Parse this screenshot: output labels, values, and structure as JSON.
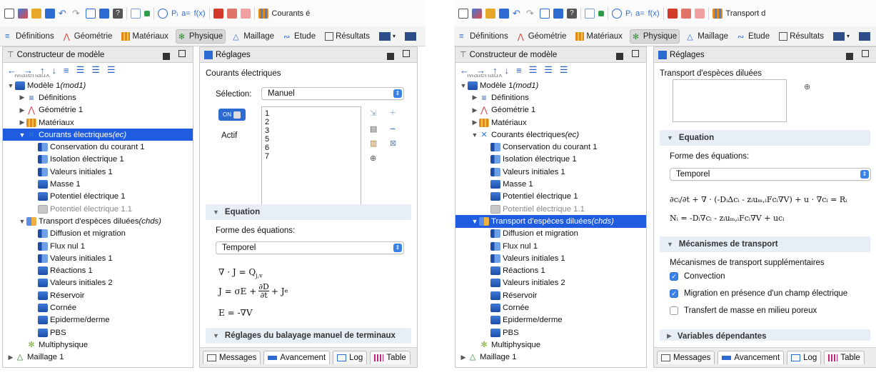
{
  "quick_access_left": {
    "truncated_title": "Courants é"
  },
  "quick_access_right": {
    "truncated_title": "Transport d"
  },
  "ribbon": {
    "tabs": [
      "Définitions",
      "Géométrie",
      "Matériaux",
      "Physique",
      "Maillage",
      "Etude",
      "Résultats"
    ],
    "active_tab": "Physique"
  },
  "builder": {
    "title": "Constructeur de modèle"
  },
  "left": {
    "tree": [
      {
        "indent": 0,
        "twisty": "",
        "icon": "none",
        "label": "Matériaux",
        "dim": true,
        "partial": true
      },
      {
        "indent": 0,
        "twisty": "▼",
        "icon": "blue",
        "label": "Modèle 1 ",
        "italic": "(mod1)"
      },
      {
        "indent": 1,
        "twisty": "▶",
        "icon": "def",
        "label": "Définitions"
      },
      {
        "indent": 1,
        "twisty": "▶",
        "icon": "geo",
        "label": "Géométrie 1"
      },
      {
        "indent": 1,
        "twisty": "▶",
        "icon": "mat",
        "label": "Matériaux"
      },
      {
        "indent": 1,
        "twisty": "▼",
        "icon": "ec",
        "label": "Courants électriques ",
        "italic": "(ec)",
        "selected": true
      },
      {
        "indent": 2,
        "twisty": "",
        "icon": "node",
        "label": "Conservation du courant 1"
      },
      {
        "indent": 2,
        "twisty": "",
        "icon": "node",
        "label": "Isolation électrique 1"
      },
      {
        "indent": 2,
        "twisty": "",
        "icon": "node",
        "label": "Valeurs initiales 1"
      },
      {
        "indent": 2,
        "twisty": "",
        "icon": "blue",
        "label": "Masse 1"
      },
      {
        "indent": 2,
        "twisty": "",
        "icon": "blue",
        "label": "Potentiel électrique 1"
      },
      {
        "indent": 2,
        "twisty": "",
        "icon": "gray",
        "label": "Potentiel électrique 1.1",
        "dim": true
      },
      {
        "indent": 1,
        "twisty": "▼",
        "icon": "chds",
        "label": "Transport d'espèces diluées ",
        "italic": "(chds)"
      },
      {
        "indent": 2,
        "twisty": "",
        "icon": "node",
        "label": "Diffusion et migration"
      },
      {
        "indent": 2,
        "twisty": "",
        "icon": "node",
        "label": "Flux nul 1"
      },
      {
        "indent": 2,
        "twisty": "",
        "icon": "node",
        "label": "Valeurs initiales 1"
      },
      {
        "indent": 2,
        "twisty": "",
        "icon": "blue",
        "label": "Réactions 1"
      },
      {
        "indent": 2,
        "twisty": "",
        "icon": "blue",
        "label": "Valeurs initiales 2"
      },
      {
        "indent": 2,
        "twisty": "",
        "icon": "blue",
        "label": "Réservoir"
      },
      {
        "indent": 2,
        "twisty": "",
        "icon": "blue",
        "label": "Cornée"
      },
      {
        "indent": 2,
        "twisty": "",
        "icon": "blue",
        "label": "Epiderme/derme"
      },
      {
        "indent": 2,
        "twisty": "",
        "icon": "blue",
        "label": "PBS"
      },
      {
        "indent": 1,
        "twisty": "",
        "icon": "multi",
        "label": "Multiphysique"
      },
      {
        "indent": 0,
        "twisty": "▶",
        "icon": "mesh",
        "label": "Maillage 1"
      }
    ],
    "settings": {
      "title": "Réglages",
      "node_name": "Courants électriques",
      "selection_label": "Sélection:",
      "selection_value": "Manuel",
      "toggle_label": "ON",
      "active_label": "Actif",
      "selection_items": [
        "1",
        "2",
        "3",
        "5",
        "6",
        "7"
      ],
      "section_equation": "Equation",
      "form_label": "Forme des équations:",
      "form_value": "Temporel",
      "eq1": "∇ · J = Q",
      "eq1_sub": "j,v",
      "eq2_lhs": "J = σE +",
      "eq2_num": "∂D",
      "eq2_den": "∂t",
      "eq2_rhs": "+ J",
      "eq2_sub": "e",
      "eq3": "E = -∇V",
      "section_sweep": "Réglages du balayage manuel de terminaux"
    }
  },
  "right": {
    "tree": [
      {
        "indent": 0,
        "twisty": "",
        "icon": "none",
        "label": "Matériaux",
        "dim": true,
        "partial": true
      },
      {
        "indent": 0,
        "twisty": "▼",
        "icon": "blue",
        "label": "Modèle 1 ",
        "italic": "(mod1)"
      },
      {
        "indent": 1,
        "twisty": "▶",
        "icon": "def",
        "label": "Définitions"
      },
      {
        "indent": 1,
        "twisty": "▶",
        "icon": "geo",
        "label": "Géométrie 1"
      },
      {
        "indent": 1,
        "twisty": "▶",
        "icon": "mat",
        "label": "Matériaux"
      },
      {
        "indent": 1,
        "twisty": "▼",
        "icon": "ec",
        "label": "Courants électriques ",
        "italic": "(ec)"
      },
      {
        "indent": 2,
        "twisty": "",
        "icon": "node",
        "label": "Conservation du courant 1"
      },
      {
        "indent": 2,
        "twisty": "",
        "icon": "node",
        "label": "Isolation électrique 1"
      },
      {
        "indent": 2,
        "twisty": "",
        "icon": "node",
        "label": "Valeurs initiales 1"
      },
      {
        "indent": 2,
        "twisty": "",
        "icon": "blue",
        "label": "Masse 1"
      },
      {
        "indent": 2,
        "twisty": "",
        "icon": "blue",
        "label": "Potentiel électrique 1"
      },
      {
        "indent": 2,
        "twisty": "",
        "icon": "gray",
        "label": "Potentiel électrique 1.1",
        "dim": true
      },
      {
        "indent": 1,
        "twisty": "▼",
        "icon": "chds",
        "label": "Transport d'espèces diluées ",
        "italic": "(chds)",
        "selected": true
      },
      {
        "indent": 2,
        "twisty": "",
        "icon": "node",
        "label": "Diffusion et migration"
      },
      {
        "indent": 2,
        "twisty": "",
        "icon": "node",
        "label": "Flux nul 1"
      },
      {
        "indent": 2,
        "twisty": "",
        "icon": "node",
        "label": "Valeurs initiales 1"
      },
      {
        "indent": 2,
        "twisty": "",
        "icon": "blue",
        "label": "Réactions 1"
      },
      {
        "indent": 2,
        "twisty": "",
        "icon": "blue",
        "label": "Valeurs initiales 2"
      },
      {
        "indent": 2,
        "twisty": "",
        "icon": "blue",
        "label": "Réservoir"
      },
      {
        "indent": 2,
        "twisty": "",
        "icon": "blue",
        "label": "Cornée"
      },
      {
        "indent": 2,
        "twisty": "",
        "icon": "blue",
        "label": "Epiderme/derme"
      },
      {
        "indent": 2,
        "twisty": "",
        "icon": "blue",
        "label": "PBS"
      },
      {
        "indent": 1,
        "twisty": "",
        "icon": "multi",
        "label": "Multiphysique"
      },
      {
        "indent": 0,
        "twisty": "▶",
        "icon": "mesh",
        "label": "Maillage 1"
      }
    ],
    "settings": {
      "title": "Réglages",
      "node_name": "Transport d'espèces diluées",
      "section_equation": "Equation",
      "form_label": "Forme des équations:",
      "form_value": "Temporel",
      "eq1": "∂cᵢ/∂t + ∇ · (-DᵢΔcᵢ - zᵢuₘ,ᵢFcᵢ∇V) + u · ∇cᵢ = Rᵢ",
      "eq2": "Nᵢ = -Dᵢ∇cᵢ - zᵢuₘ,ᵢFcᵢ∇V + ucᵢ",
      "section_transport": "Mécanismes de transport",
      "transport_label": "Mécanismes de transport supplémentaires",
      "checks": [
        {
          "label": "Convection",
          "checked": true
        },
        {
          "label": "Migration en présence d'un champ électrique",
          "checked": true
        },
        {
          "label": "Transfert de masse en milieu poreux",
          "checked": false
        }
      ],
      "section_variables": "Variables dépendantes"
    }
  },
  "bottom_tabs": [
    "Messages",
    "Avancement",
    "Log",
    "Table"
  ],
  "colors": {
    "selection": "#1f5ce0",
    "accent": "#3b82e6",
    "section_bg": "#e8eef6"
  }
}
